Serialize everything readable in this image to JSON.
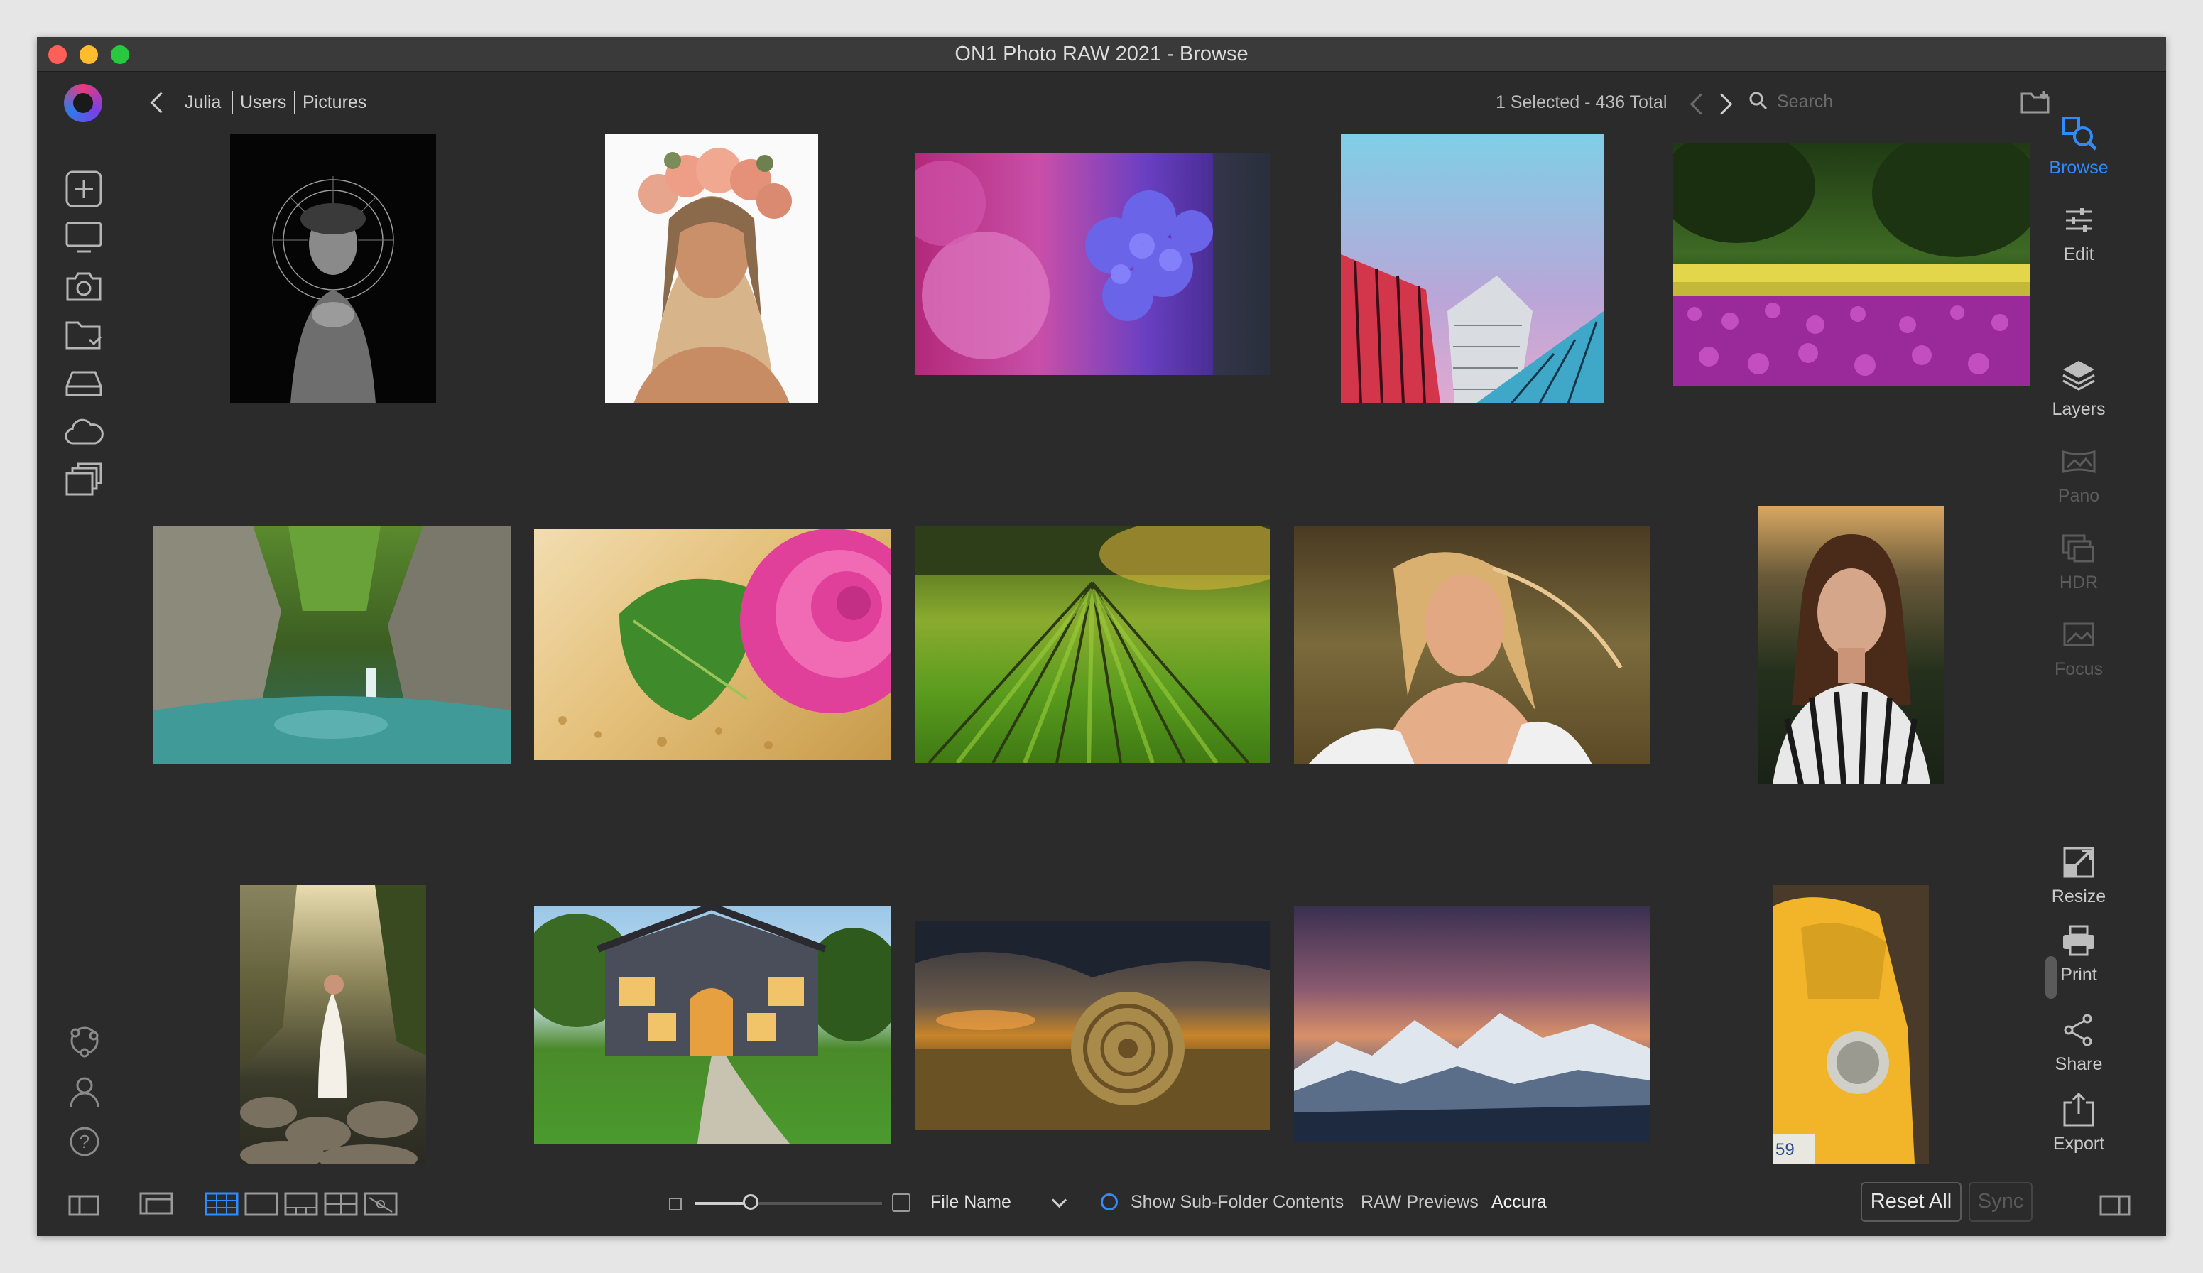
{
  "window": {
    "title": "ON1 Photo RAW 2021 - Browse"
  },
  "breadcrumb": [
    "Julia",
    "Users",
    "Pictures"
  ],
  "status": {
    "selection": "1 Selected - 436 Total"
  },
  "search": {
    "placeholder": "Search",
    "value": ""
  },
  "left_sidebar": {
    "icons": [
      "add-icon",
      "monitor-icon",
      "camera-icon",
      "folder-icon",
      "drive-icon",
      "cloud-icon",
      "albums-icon"
    ],
    "bottom_icons": [
      "extensions-icon",
      "account-icon",
      "help-icon"
    ]
  },
  "right_sidebar": {
    "items": [
      {
        "label": "Browse",
        "icon": "browse-icon",
        "state": "active"
      },
      {
        "label": "Edit",
        "icon": "sliders-icon",
        "state": "normal"
      },
      {
        "label": "Layers",
        "icon": "layers-icon",
        "state": "normal"
      },
      {
        "label": "Pano",
        "icon": "pano-icon",
        "state": "disabled"
      },
      {
        "label": "HDR",
        "icon": "hdr-icon",
        "state": "disabled"
      },
      {
        "label": "Focus",
        "icon": "focus-icon",
        "state": "disabled"
      },
      {
        "label": "Resize",
        "icon": "resize-icon",
        "state": "normal"
      },
      {
        "label": "Print",
        "icon": "print-icon",
        "state": "normal"
      },
      {
        "label": "Share",
        "icon": "share-icon",
        "state": "normal"
      },
      {
        "label": "Export",
        "icon": "export-icon",
        "state": "normal"
      }
    ]
  },
  "photos": [
    {
      "subject": "black and white portrait with halo headdress"
    },
    {
      "subject": "woman with flower crown"
    },
    {
      "subject": "pink and blue flowers macro"
    },
    {
      "subject": "colorful buildings against sky"
    },
    {
      "subject": "tulip field in park"
    },
    {
      "subject": "forest waterfall"
    },
    {
      "subject": "pink rose with leaf"
    },
    {
      "subject": "vineyard rows"
    },
    {
      "subject": "blonde woman in field"
    },
    {
      "subject": "woman in striped shirt"
    },
    {
      "subject": "bride on rocks by stream"
    },
    {
      "subject": "house with lit porch"
    },
    {
      "subject": "hay bale at sunset"
    },
    {
      "subject": "snowy mountains at dusk"
    },
    {
      "subject": "yellow vintage car"
    }
  ],
  "bottom_bar": {
    "sort_label": "File Name",
    "subfolder_label": "Show Sub-Folder Contents",
    "raw_previews_label": "RAW Previews",
    "raw_previews_value": "Accura",
    "reset_all": "Reset All",
    "sync": "Sync",
    "thumbnail_size": 0.3
  },
  "colors": {
    "accent": "#2f8cff",
    "background": "#2b2b2b",
    "titlebar": "#3a3a3a"
  }
}
